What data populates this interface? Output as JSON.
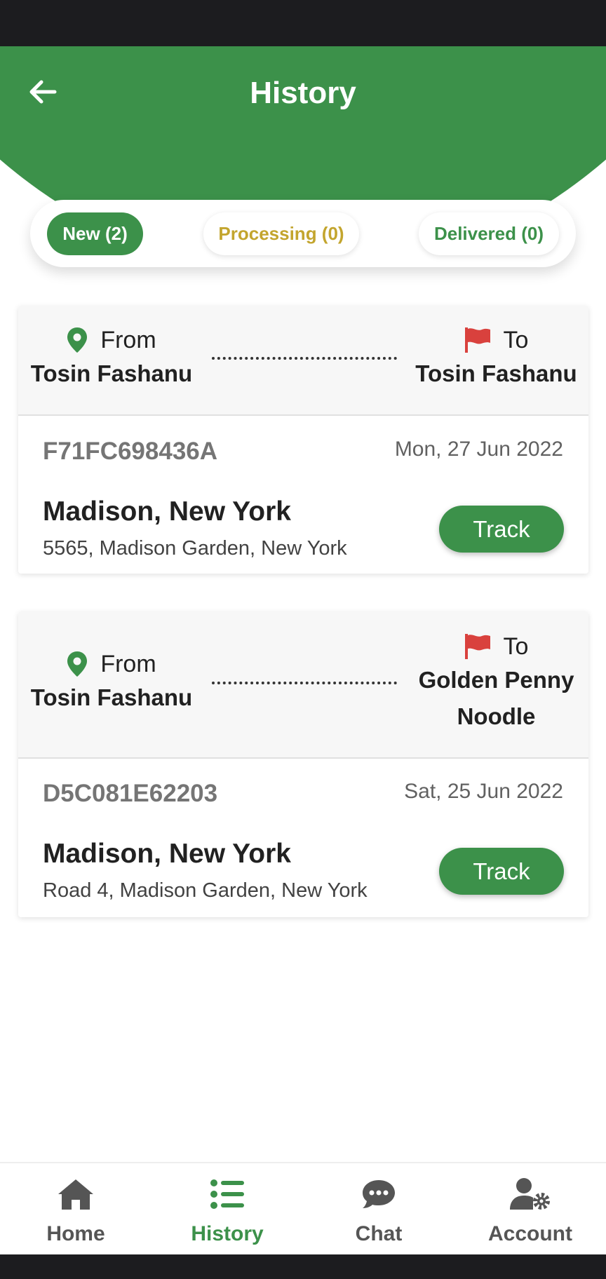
{
  "header": {
    "title": "History"
  },
  "tabs": [
    {
      "label": "New (2)"
    },
    {
      "label": "Processing (0)"
    },
    {
      "label": "Delivered (0)"
    }
  ],
  "orders": [
    {
      "from_label": "From",
      "from_name": "Tosin Fashanu",
      "to_label": "To",
      "to_name": "Tosin Fashanu",
      "id": "F71FC698436A",
      "date": "Mon, 27 Jun 2022",
      "city": "Madison, New York",
      "address": "5565, Madison Garden, New York",
      "track_label": "Track"
    },
    {
      "from_label": "From",
      "from_name": "Tosin Fashanu",
      "to_label": "To",
      "to_name_line1": "Golden Penny",
      "to_name_line2": "Noodle",
      "id": "D5C081E62203",
      "date": "Sat, 25 Jun 2022",
      "city": "Madison, New York",
      "address": "Road 4, Madison Garden, New York",
      "track_label": "Track"
    }
  ],
  "nav": [
    {
      "label": "Home",
      "icon": "home-icon"
    },
    {
      "label": "History",
      "icon": "list-icon",
      "active": true
    },
    {
      "label": "Chat",
      "icon": "chat-bubble-icon"
    },
    {
      "label": "Account",
      "icon": "user-settings-icon"
    }
  ],
  "colors": {
    "primary_green": "#3c914a",
    "processing_gold": "#c3a52e",
    "flag_red": "#d9413d",
    "status_bar": "#1c1c1f"
  }
}
